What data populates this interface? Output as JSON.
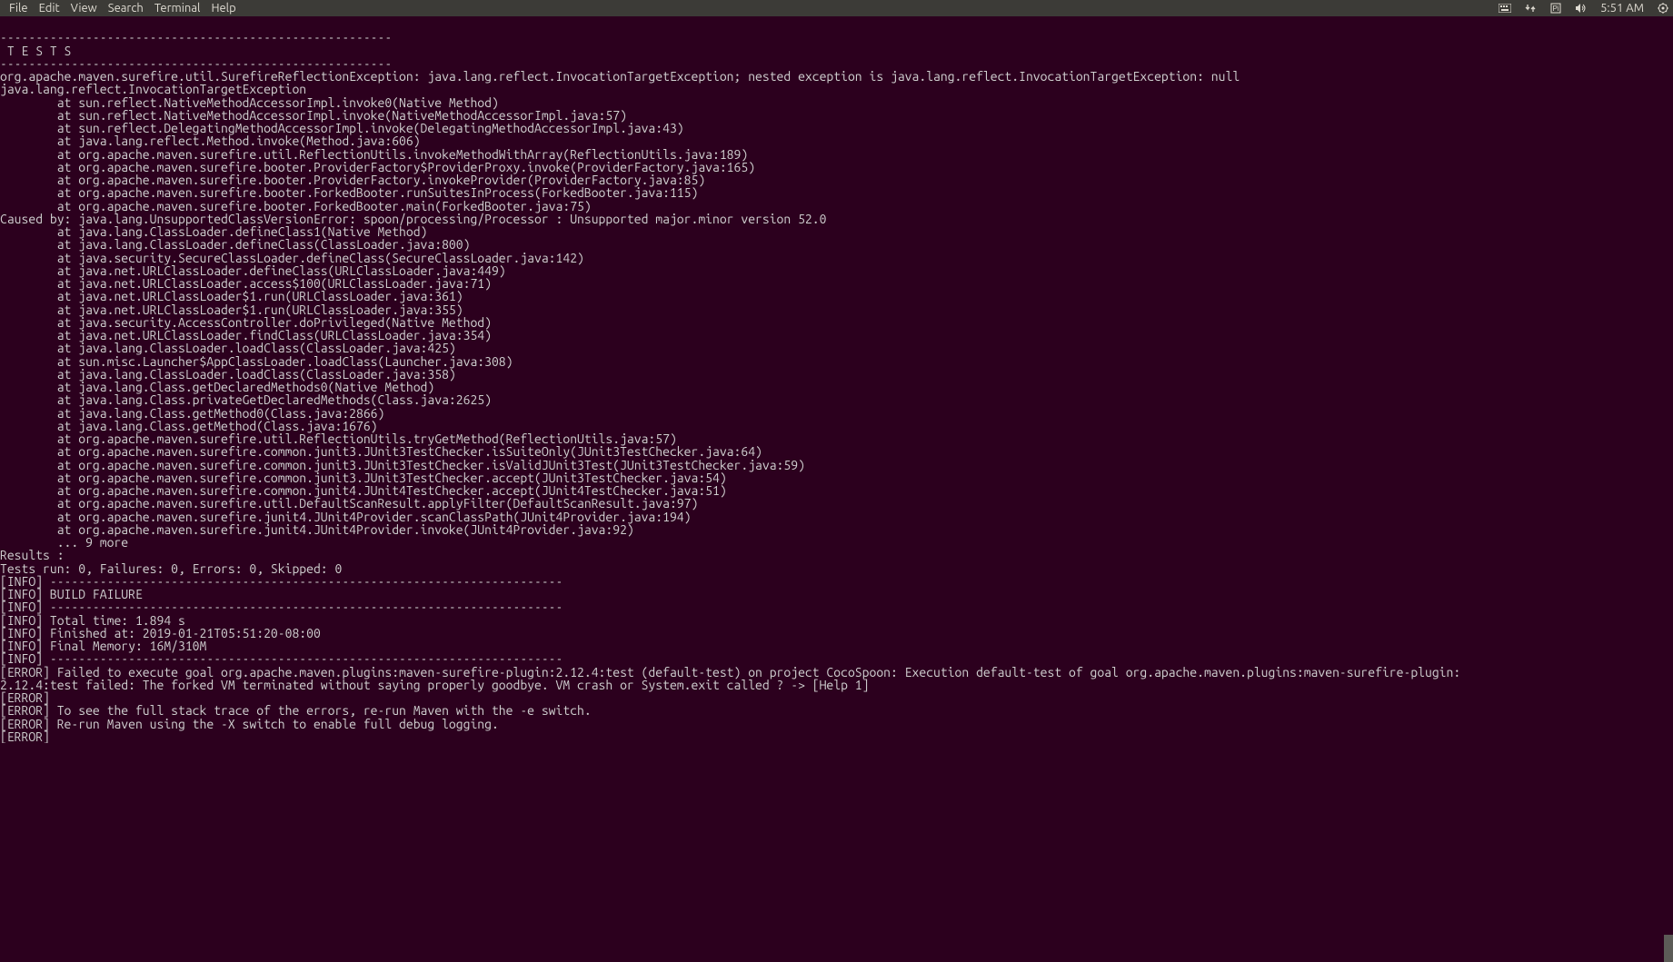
{
  "menubar": {
    "items": [
      "File",
      "Edit",
      "View",
      "Search",
      "Terminal",
      "Help"
    ],
    "clock": "5:51 AM"
  },
  "terminal": {
    "lines": [
      "-------------------------------------------------------",
      " T E S T S",
      "-------------------------------------------------------",
      "org.apache.maven.surefire.util.SurefireReflectionException: java.lang.reflect.InvocationTargetException; nested exception is java.lang.reflect.InvocationTargetException: null",
      "java.lang.reflect.InvocationTargetException",
      "        at sun.reflect.NativeMethodAccessorImpl.invoke0(Native Method)",
      "        at sun.reflect.NativeMethodAccessorImpl.invoke(NativeMethodAccessorImpl.java:57)",
      "        at sun.reflect.DelegatingMethodAccessorImpl.invoke(DelegatingMethodAccessorImpl.java:43)",
      "        at java.lang.reflect.Method.invoke(Method.java:606)",
      "        at org.apache.maven.surefire.util.ReflectionUtils.invokeMethodWithArray(ReflectionUtils.java:189)",
      "        at org.apache.maven.surefire.booter.ProviderFactory$ProviderProxy.invoke(ProviderFactory.java:165)",
      "        at org.apache.maven.surefire.booter.ProviderFactory.invokeProvider(ProviderFactory.java:85)",
      "        at org.apache.maven.surefire.booter.ForkedBooter.runSuitesInProcess(ForkedBooter.java:115)",
      "        at org.apache.maven.surefire.booter.ForkedBooter.main(ForkedBooter.java:75)",
      "Caused by: java.lang.UnsupportedClassVersionError: spoon/processing/Processor : Unsupported major.minor version 52.0",
      "        at java.lang.ClassLoader.defineClass1(Native Method)",
      "        at java.lang.ClassLoader.defineClass(ClassLoader.java:800)",
      "        at java.security.SecureClassLoader.defineClass(SecureClassLoader.java:142)",
      "        at java.net.URLClassLoader.defineClass(URLClassLoader.java:449)",
      "        at java.net.URLClassLoader.access$100(URLClassLoader.java:71)",
      "        at java.net.URLClassLoader$1.run(URLClassLoader.java:361)",
      "        at java.net.URLClassLoader$1.run(URLClassLoader.java:355)",
      "        at java.security.AccessController.doPrivileged(Native Method)",
      "        at java.net.URLClassLoader.findClass(URLClassLoader.java:354)",
      "        at java.lang.ClassLoader.loadClass(ClassLoader.java:425)",
      "        at sun.misc.Launcher$AppClassLoader.loadClass(Launcher.java:308)",
      "        at java.lang.ClassLoader.loadClass(ClassLoader.java:358)",
      "        at java.lang.Class.getDeclaredMethods0(Native Method)",
      "        at java.lang.Class.privateGetDeclaredMethods(Class.java:2625)",
      "        at java.lang.Class.getMethod0(Class.java:2866)",
      "        at java.lang.Class.getMethod(Class.java:1676)",
      "        at org.apache.maven.surefire.util.ReflectionUtils.tryGetMethod(ReflectionUtils.java:57)",
      "        at org.apache.maven.surefire.common.junit3.JUnit3TestChecker.isSuiteOnly(JUnit3TestChecker.java:64)",
      "        at org.apache.maven.surefire.common.junit3.JUnit3TestChecker.isValidJUnit3Test(JUnit3TestChecker.java:59)",
      "        at org.apache.maven.surefire.common.junit3.JUnit3TestChecker.accept(JUnit3TestChecker.java:54)",
      "        at org.apache.maven.surefire.common.junit4.JUnit4TestChecker.accept(JUnit4TestChecker.java:51)",
      "        at org.apache.maven.surefire.util.DefaultScanResult.applyFilter(DefaultScanResult.java:97)",
      "        at org.apache.maven.surefire.junit4.JUnit4Provider.scanClassPath(JUnit4Provider.java:194)",
      "        at org.apache.maven.surefire.junit4.JUnit4Provider.invoke(JUnit4Provider.java:92)",
      "        ... 9 more",
      "",
      "Results :",
      "",
      "Tests run: 0, Failures: 0, Errors: 0, Skipped: 0",
      "",
      "[INFO] ------------------------------------------------------------------------",
      "[INFO] BUILD FAILURE",
      "[INFO] ------------------------------------------------------------------------",
      "[INFO] Total time: 1.894 s",
      "[INFO] Finished at: 2019-01-21T05:51:20-08:00",
      "[INFO] Final Memory: 16M/310M",
      "[INFO] ------------------------------------------------------------------------",
      "[ERROR] Failed to execute goal org.apache.maven.plugins:maven-surefire-plugin:2.12.4:test (default-test) on project CocoSpoon: Execution default-test of goal org.apache.maven.plugins:maven-surefire-plugin:",
      "2.12.4:test failed: The forked VM terminated without saying properly goodbye. VM crash or System.exit called ? -> [Help 1]",
      "[ERROR]",
      "[ERROR] To see the full stack trace of the errors, re-run Maven with the -e switch.",
      "[ERROR] Re-run Maven using the -X switch to enable full debug logging.",
      "[ERROR]"
    ]
  }
}
